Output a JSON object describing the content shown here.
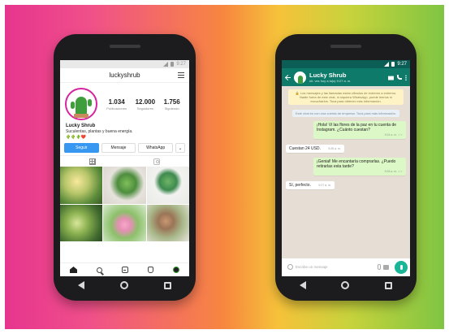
{
  "instagram": {
    "status_time": "9:27",
    "username": "luckyshrub",
    "stats": [
      {
        "value": "1.034",
        "label": "Publicaciones"
      },
      {
        "value": "12.000",
        "label": "Seguidores"
      },
      {
        "value": "1.756",
        "label": "Siguiendo"
      }
    ],
    "bio_name": "Lucky Shrub",
    "bio_text": "Suculentas, plantas y buena energía.",
    "bio_emojis": "🌵🌵🌵❤️",
    "buttons": {
      "follow": "Seguir",
      "message": "Mensaje",
      "whatsapp": "WhatsApp",
      "more": "⌄"
    }
  },
  "whatsapp": {
    "status_time": "9:27",
    "contact_name": "Lucky Shrub",
    "contact_status": "últ. vez hoy a la(s) 9:27 a. m.",
    "notice": "🔒 Los mensajes y las llamadas están cifrados de extremo a extremo. Nadie fuera de este chat, ni siquiera WhatsApp, puede leerlos ni escucharlos. Toca para obtener más información.",
    "system": "Este chat es con una cuenta de empresa. Toca para más información.",
    "messages": [
      {
        "dir": "out",
        "text": "¡Hola! Vi las flores de la paz en tu cuenta de Instagram. ¿Cuánto cuestan?",
        "time": "9:24 a. m. ✓✓"
      },
      {
        "dir": "in",
        "text": "Cuestan 24 USD.",
        "time": "9:25 a. m."
      },
      {
        "dir": "out",
        "text": "¡Genial! Me encantaría comprarlas. ¿Puedo retirarlas esta tarde?",
        "time": "9:26 a. m. ✓✓"
      },
      {
        "dir": "in",
        "text": "Sí, perfecto.",
        "time": "9:27 a. m."
      }
    ],
    "input_placeholder": "Escribe un mensaje"
  }
}
